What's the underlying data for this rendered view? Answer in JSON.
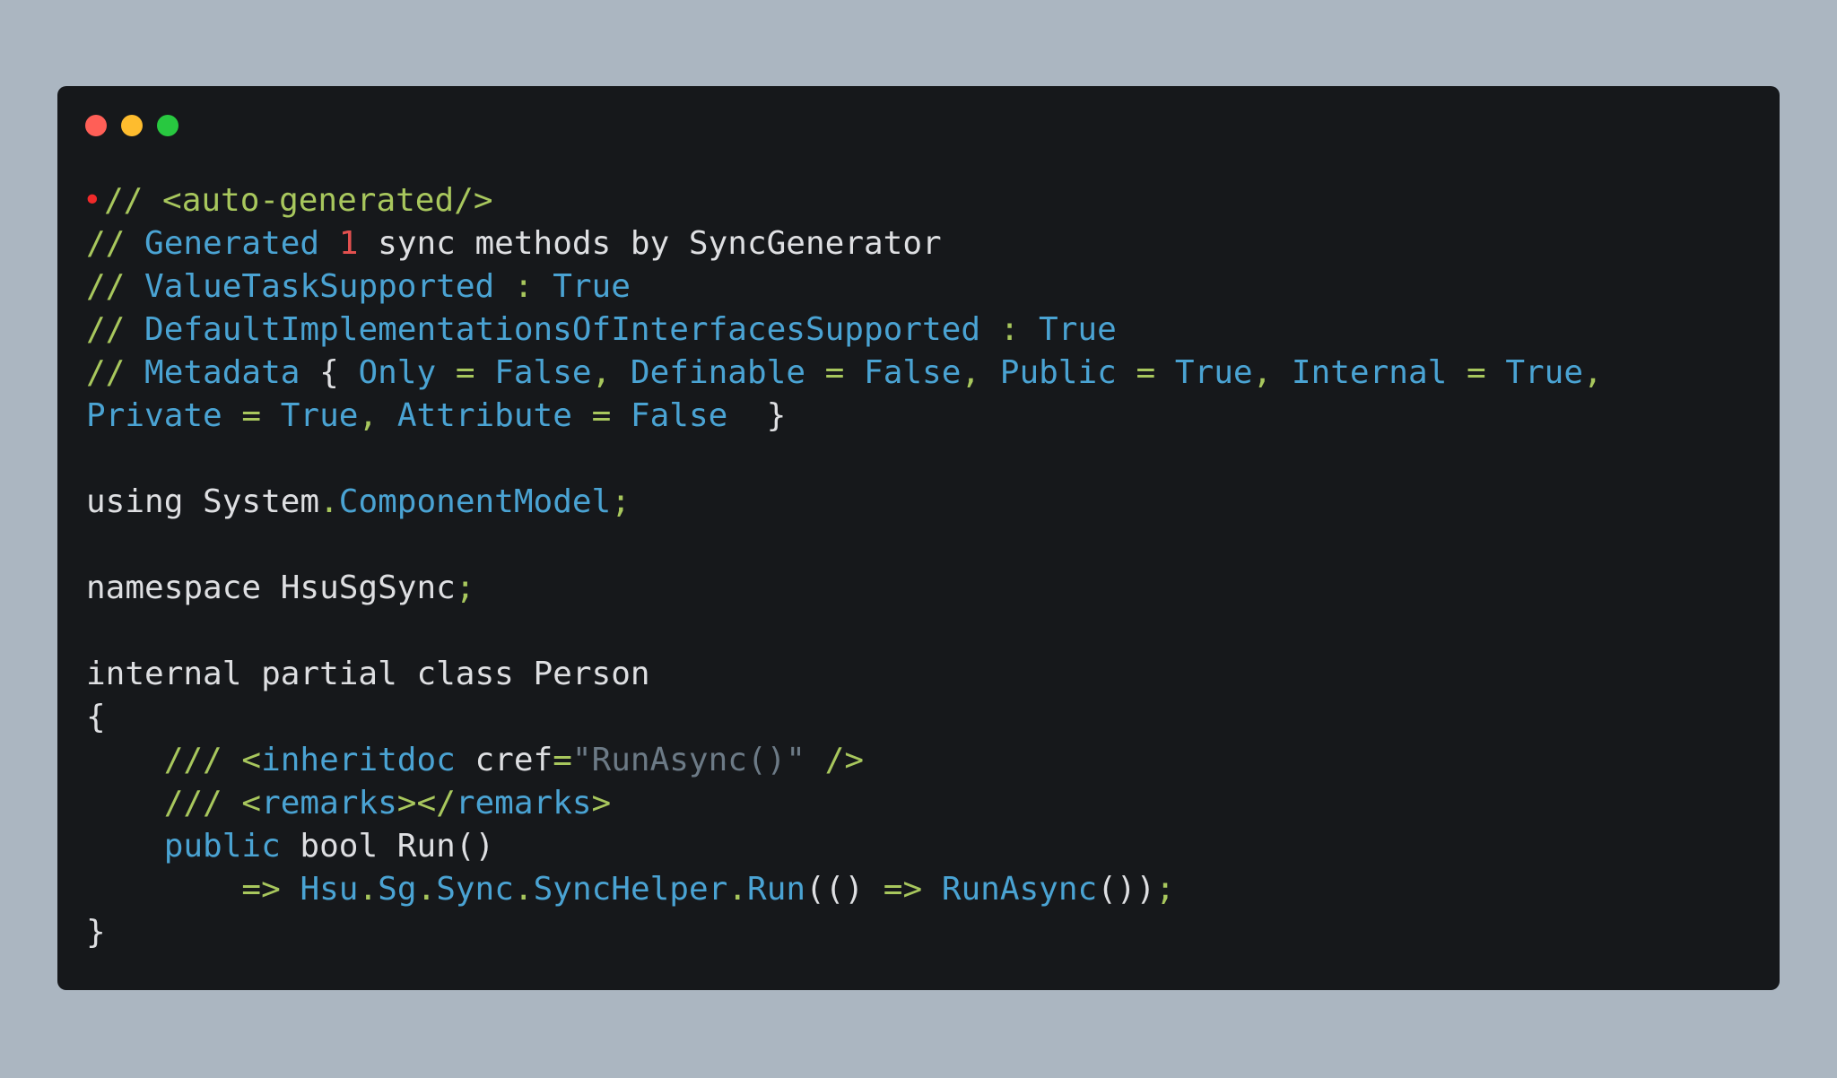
{
  "window_controls": {
    "close_color": "#ff5f57",
    "minimize_color": "#febc2e",
    "maximize_color": "#28c840"
  },
  "code": {
    "breakpoint_glyph": "•",
    "lines": [
      {
        "tokens": [
          {
            "t": "// ",
            "c": "green"
          },
          {
            "t": "<auto-generated/>",
            "c": "green"
          }
        ]
      },
      {
        "tokens": [
          {
            "t": "// ",
            "c": "green"
          },
          {
            "t": "Generated ",
            "c": "blue"
          },
          {
            "t": "1",
            "c": "red"
          },
          {
            "t": " sync methods by SyncGenerator",
            "c": "white"
          }
        ]
      },
      {
        "tokens": [
          {
            "t": "// ",
            "c": "green"
          },
          {
            "t": "ValueTaskSupported",
            "c": "blue"
          },
          {
            "t": " : ",
            "c": "green"
          },
          {
            "t": "True",
            "c": "blue"
          }
        ]
      },
      {
        "tokens": [
          {
            "t": "// ",
            "c": "green"
          },
          {
            "t": "DefaultImplementationsOfInterfacesSupported",
            "c": "blue"
          },
          {
            "t": " : ",
            "c": "green"
          },
          {
            "t": "True",
            "c": "blue"
          }
        ]
      },
      {
        "tokens": [
          {
            "t": "// ",
            "c": "green"
          },
          {
            "t": "Metadata",
            "c": "blue"
          },
          {
            "t": " { ",
            "c": "white"
          },
          {
            "t": "Only",
            "c": "blue"
          },
          {
            "t": " = ",
            "c": "green"
          },
          {
            "t": "False",
            "c": "blue"
          },
          {
            "t": ", ",
            "c": "green"
          },
          {
            "t": "Definable",
            "c": "blue"
          },
          {
            "t": " = ",
            "c": "green"
          },
          {
            "t": "False",
            "c": "blue"
          },
          {
            "t": ", ",
            "c": "green"
          },
          {
            "t": "Public",
            "c": "blue"
          },
          {
            "t": " = ",
            "c": "green"
          },
          {
            "t": "True",
            "c": "blue"
          },
          {
            "t": ", ",
            "c": "green"
          },
          {
            "t": "Internal",
            "c": "blue"
          },
          {
            "t": " = ",
            "c": "green"
          },
          {
            "t": "True",
            "c": "blue"
          },
          {
            "t": ",",
            "c": "green"
          }
        ]
      },
      {
        "tokens": [
          {
            "t": "Private",
            "c": "blue"
          },
          {
            "t": " = ",
            "c": "green"
          },
          {
            "t": "True",
            "c": "blue"
          },
          {
            "t": ", ",
            "c": "green"
          },
          {
            "t": "Attribute",
            "c": "blue"
          },
          {
            "t": " = ",
            "c": "green"
          },
          {
            "t": "False",
            "c": "blue"
          },
          {
            "t": "  }",
            "c": "white"
          }
        ]
      },
      {
        "tokens": []
      },
      {
        "tokens": [
          {
            "t": "using System",
            "c": "white"
          },
          {
            "t": ".",
            "c": "green"
          },
          {
            "t": "ComponentModel",
            "c": "blue"
          },
          {
            "t": ";",
            "c": "green"
          }
        ]
      },
      {
        "tokens": []
      },
      {
        "tokens": [
          {
            "t": "namespace HsuSgSync",
            "c": "white"
          },
          {
            "t": ";",
            "c": "green"
          }
        ]
      },
      {
        "tokens": []
      },
      {
        "tokens": [
          {
            "t": "internal partial class Person",
            "c": "white"
          }
        ]
      },
      {
        "tokens": [
          {
            "t": "{",
            "c": "white"
          }
        ]
      },
      {
        "tokens": [
          {
            "t": "    /// ",
            "c": "green"
          },
          {
            "t": "<",
            "c": "green"
          },
          {
            "t": "inheritdoc",
            "c": "blue"
          },
          {
            "t": " cref",
            "c": "white"
          },
          {
            "t": "=",
            "c": "green"
          },
          {
            "t": "\"RunAsync()\"",
            "c": "gray"
          },
          {
            "t": " />",
            "c": "green"
          }
        ]
      },
      {
        "tokens": [
          {
            "t": "    /// ",
            "c": "green"
          },
          {
            "t": "<",
            "c": "green"
          },
          {
            "t": "remarks",
            "c": "blue"
          },
          {
            "t": "></",
            "c": "green"
          },
          {
            "t": "remarks",
            "c": "blue"
          },
          {
            "t": ">",
            "c": "green"
          }
        ]
      },
      {
        "tokens": [
          {
            "t": "    ",
            "c": "white"
          },
          {
            "t": "public",
            "c": "blue"
          },
          {
            "t": " bool Run()",
            "c": "white"
          }
        ]
      },
      {
        "tokens": [
          {
            "t": "        ",
            "c": "white"
          },
          {
            "t": "=>",
            "c": "green"
          },
          {
            "t": " ",
            "c": "white"
          },
          {
            "t": "Hsu",
            "c": "blue"
          },
          {
            "t": ".",
            "c": "green"
          },
          {
            "t": "Sg",
            "c": "blue"
          },
          {
            "t": ".",
            "c": "green"
          },
          {
            "t": "Sync",
            "c": "blue"
          },
          {
            "t": ".",
            "c": "green"
          },
          {
            "t": "SyncHelper",
            "c": "blue"
          },
          {
            "t": ".",
            "c": "green"
          },
          {
            "t": "Run",
            "c": "blue"
          },
          {
            "t": "(() ",
            "c": "white"
          },
          {
            "t": "=>",
            "c": "green"
          },
          {
            "t": " ",
            "c": "white"
          },
          {
            "t": "RunAsync",
            "c": "blue"
          },
          {
            "t": "())",
            "c": "white"
          },
          {
            "t": ";",
            "c": "green"
          }
        ]
      },
      {
        "tokens": [
          {
            "t": "}",
            "c": "white"
          }
        ]
      }
    ]
  }
}
